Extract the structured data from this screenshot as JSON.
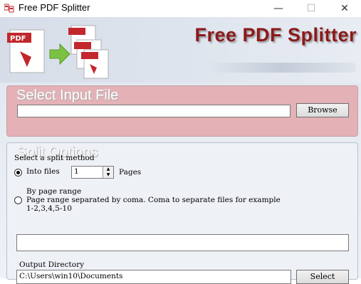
{
  "window": {
    "title": "Free PDF Splitter",
    "minimize_glyph": "—",
    "maximize_glyph": "☐",
    "close_glyph": "✕"
  },
  "header": {
    "brand_title": "Free PDF Splitter",
    "logo_icons": [
      "pdf-document-icon",
      "green-arrow-icon",
      "split-pdf-documents-icon"
    ],
    "brand_color": "#8b1a1a"
  },
  "input_section": {
    "heading": "Select Input File",
    "file_path": "",
    "browse_label": "Browse",
    "panel_color": "#e3b1b6"
  },
  "split_section": {
    "heading": "Split Options",
    "method_label": "Select a split method",
    "into_files_label": "Into files",
    "into_files_value": "1",
    "pages_label": "Pages",
    "by_range_label": "By page range",
    "range_help_line1": "Page range separated by coma. Coma to separate files for example",
    "range_help_line2": "1-2,3,4,5-10",
    "range_value": "",
    "selected_method": "into_files"
  },
  "output_section": {
    "label": "Output Directory",
    "path": "C:\\Users\\win10\\Documents",
    "select_label": "Select"
  }
}
